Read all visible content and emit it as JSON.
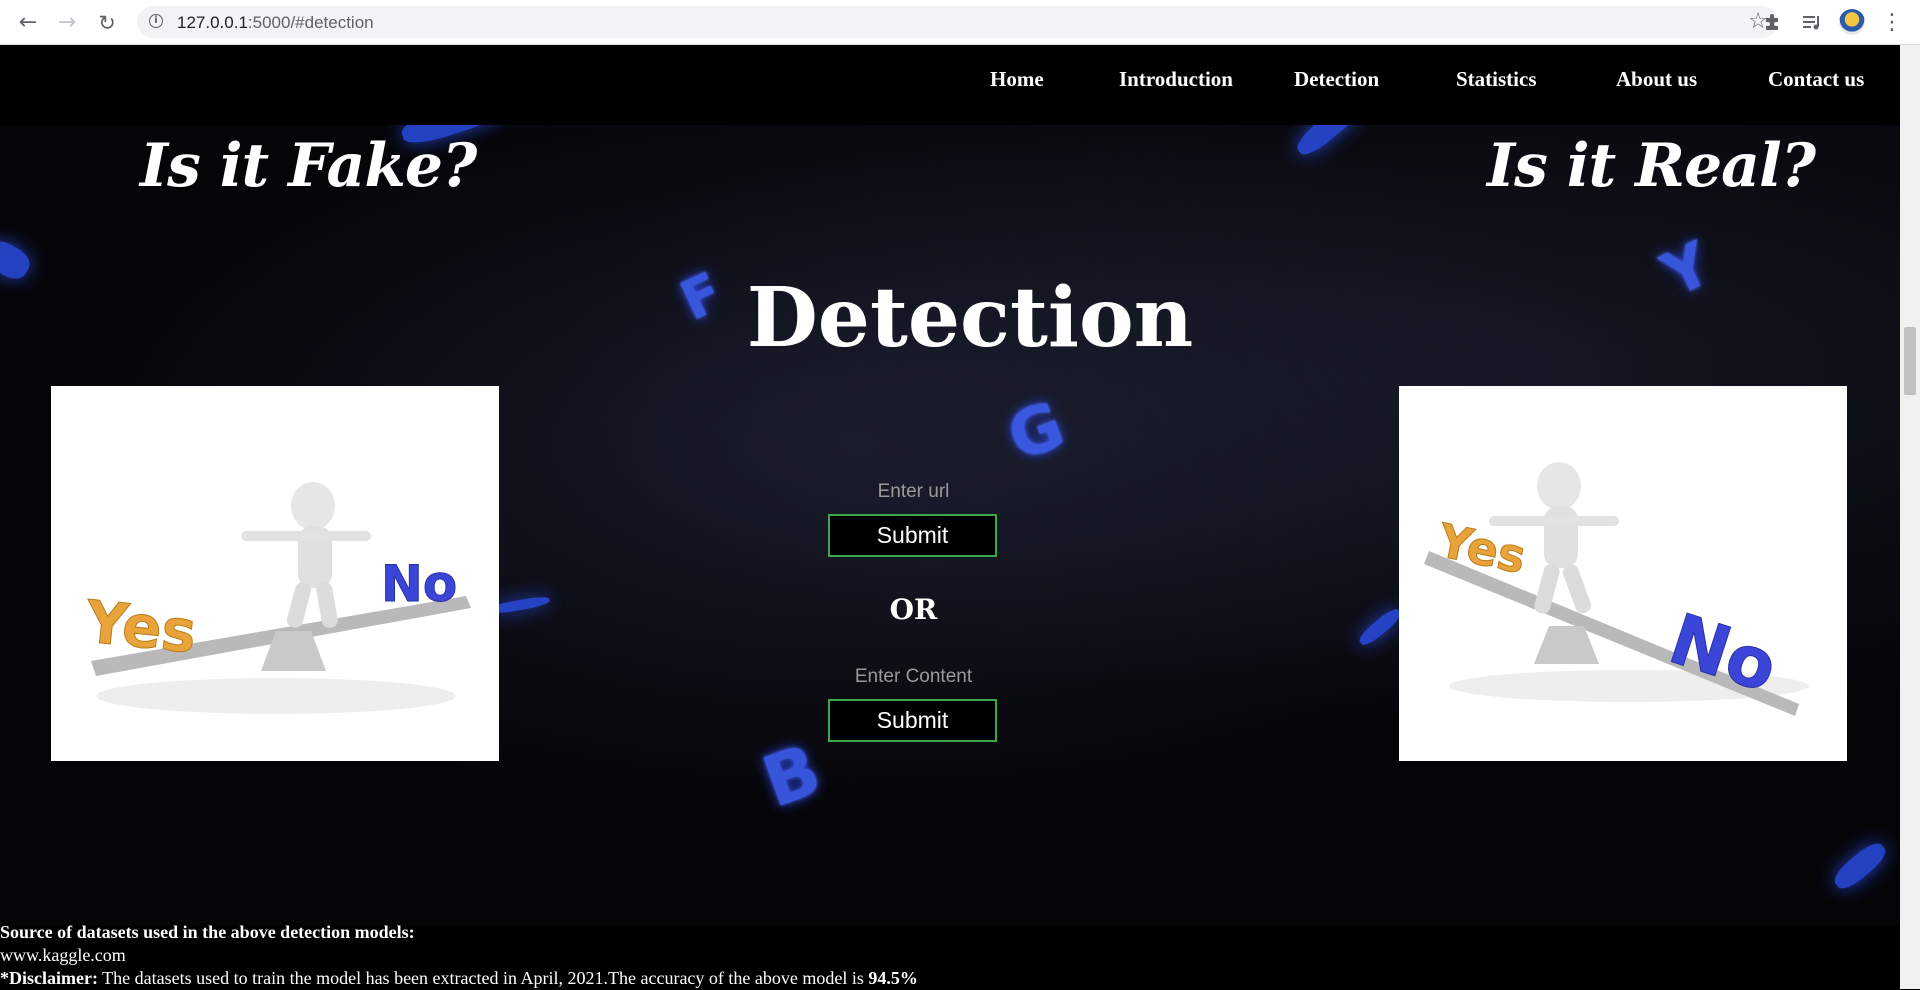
{
  "browser": {
    "url_host": "127.0.0.1",
    "url_rest": ":5000/#detection",
    "icons": [
      "back-arrow-icon",
      "forward-arrow-icon",
      "reload-icon",
      "site-info-icon",
      "bookmark-star-icon",
      "extensions-puzzle-icon",
      "reading-list-icon",
      "profile-avatar-icon",
      "menu-kebab-icon"
    ]
  },
  "nav": {
    "items": [
      "Home",
      "Introduction",
      "Detection",
      "Statistics",
      "About us",
      "Contact us"
    ]
  },
  "hero": {
    "left_title": "Is it Fake?",
    "right_title": "Is it Real?",
    "title": "Detection",
    "left_image_text": [
      "Yes",
      "No"
    ],
    "right_image_text": [
      "Yes",
      "No"
    ]
  },
  "form": {
    "url_placeholder": "Enter url",
    "url_submit": "Submit",
    "or_label": "OR",
    "content_placeholder": "Enter Content",
    "content_submit": "Submit"
  },
  "footer": {
    "source_heading": "Source of datasets used in the above detection models:",
    "source_site": "www.kaggle.com",
    "disclaimer_label": "*Disclaimer:",
    "disclaimer_text": " The datasets used to train the model has been extracted in April, 2021.The accuracy of the above model is ",
    "accuracy": "94.5%"
  },
  "colors": {
    "background": "#000000",
    "button_border": "#3aa84a",
    "key_glow": "#3f63ff",
    "yes_orange": "#e8a33a",
    "no_blue": "#3b46d8"
  }
}
